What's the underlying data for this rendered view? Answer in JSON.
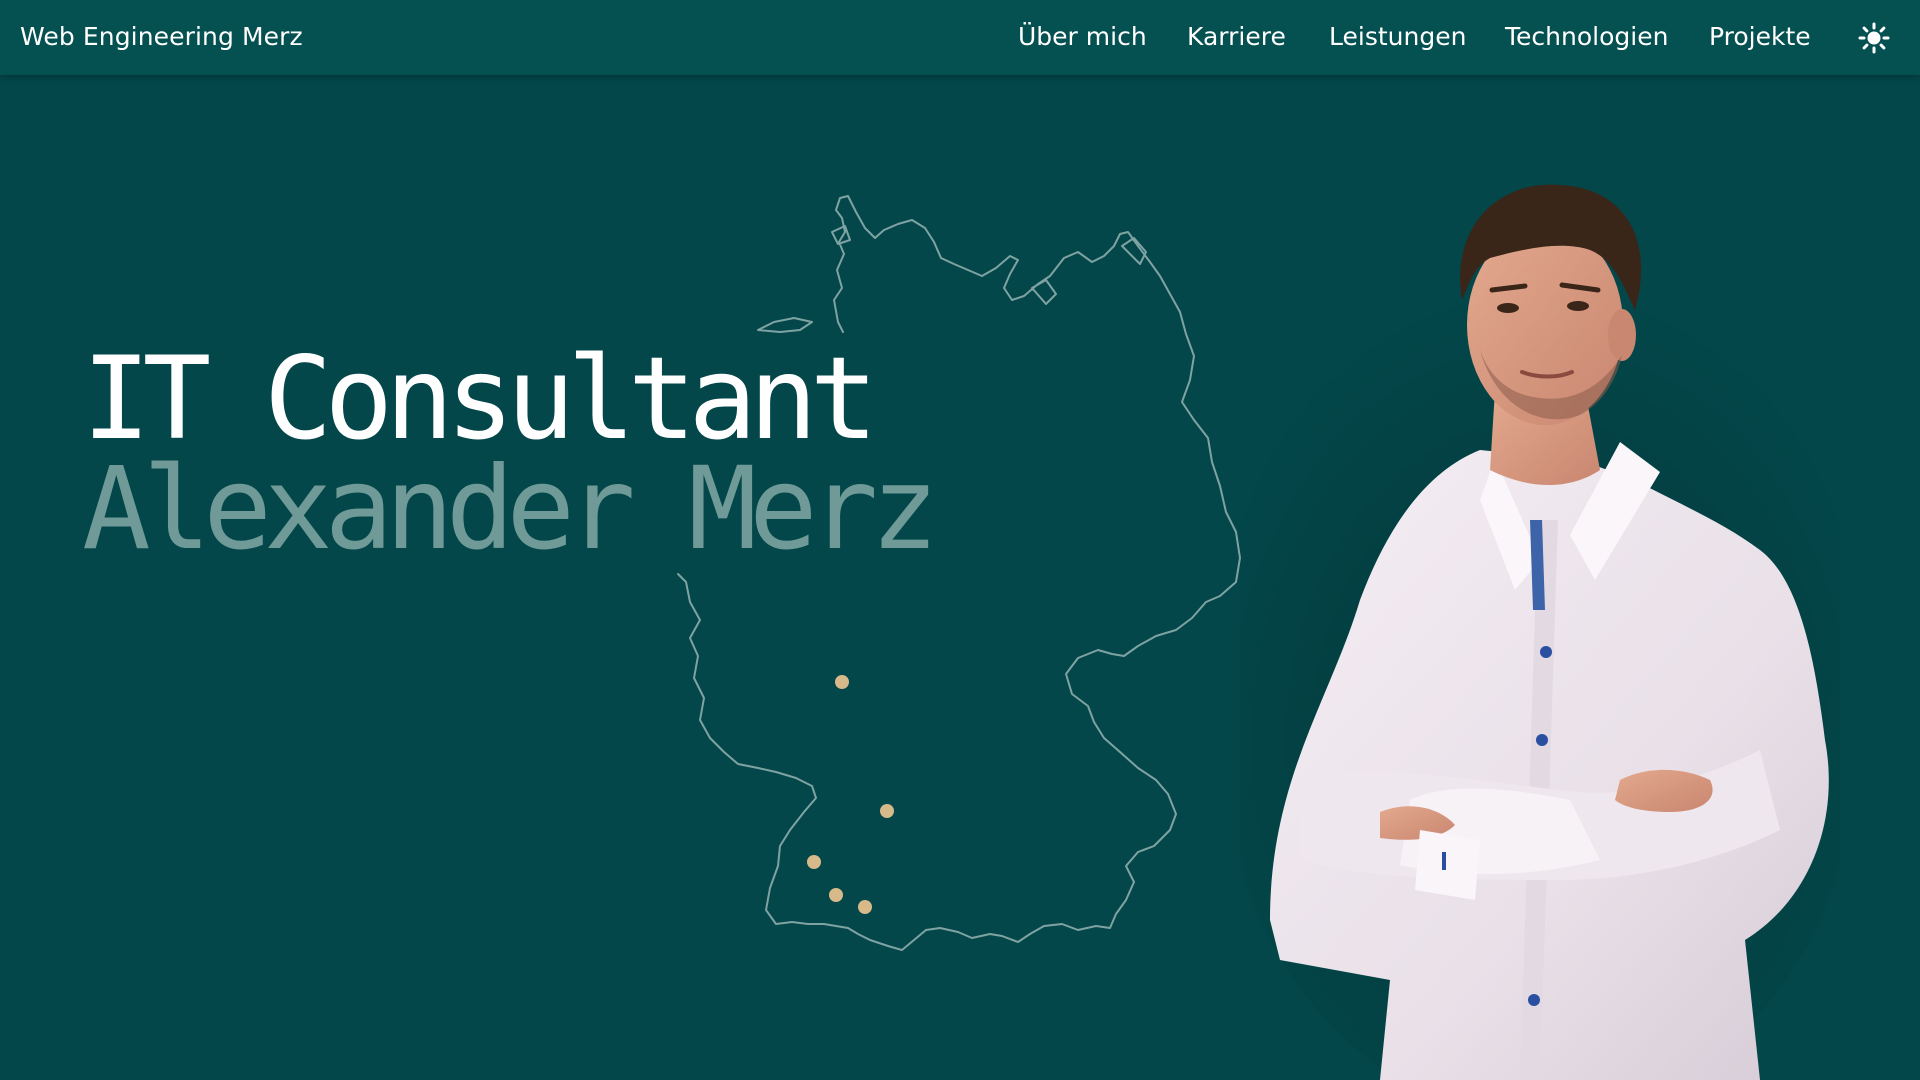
{
  "header": {
    "brand": "Web Engineering Merz",
    "nav": [
      "Über mich",
      "Karriere",
      "Leistungen",
      "Technologien",
      "Projekte"
    ],
    "theme_toggle_icon": "sun-icon"
  },
  "hero": {
    "title": "IT Consultant",
    "subtitle": "Alexander Merz"
  },
  "map": {
    "location_markers": 5,
    "colors": {
      "outline": "#7fa3a2",
      "marker": "#d8b98a"
    }
  },
  "colors": {
    "background": "#03474a",
    "header": "#055051",
    "title": "#ffffff",
    "subtitle": "#6f9a97"
  }
}
